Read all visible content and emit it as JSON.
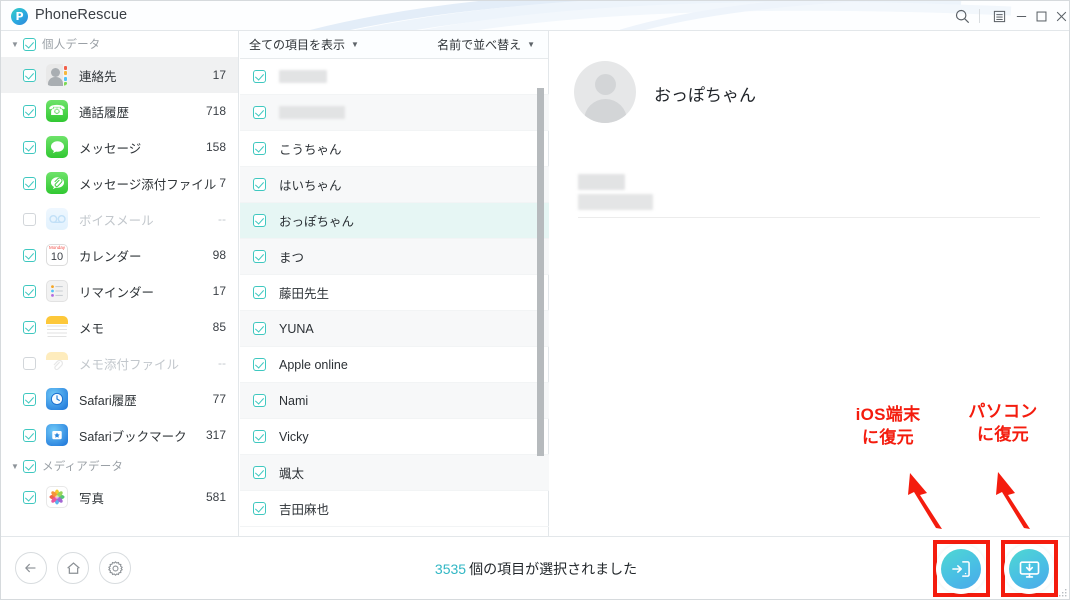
{
  "window": {
    "title": "PhoneRescue",
    "logo_glyph": "P",
    "controls": [
      {
        "name": "search-icon",
        "glyph": "search"
      },
      {
        "name": "menu-icon",
        "glyph": "menu"
      },
      {
        "name": "minimize-button",
        "glyph": "minimize"
      },
      {
        "name": "maximize-button",
        "glyph": "maximize"
      },
      {
        "name": "close-button",
        "glyph": "close"
      }
    ]
  },
  "sidebar": {
    "groups": [
      {
        "label": "個人データ",
        "checked": true,
        "expanded": true,
        "items": [
          {
            "label": "連絡先",
            "count": "17",
            "checked": true,
            "enabled": true,
            "selected": true,
            "icon": "contacts-icon"
          },
          {
            "label": "通話履歴",
            "count": "718",
            "checked": true,
            "enabled": true,
            "selected": false,
            "icon": "phone-icon"
          },
          {
            "label": "メッセージ",
            "count": "158",
            "checked": true,
            "enabled": true,
            "selected": false,
            "icon": "messages-icon"
          },
          {
            "label": "メッセージ添付ファイル",
            "count": "7",
            "checked": true,
            "enabled": true,
            "selected": false,
            "icon": "message-attachment-icon"
          },
          {
            "label": "ボイスメール",
            "count": "--",
            "checked": false,
            "enabled": false,
            "selected": false,
            "icon": "voicemail-icon"
          },
          {
            "label": "カレンダー",
            "count": "98",
            "checked": true,
            "enabled": true,
            "selected": false,
            "icon": "calendar-icon"
          },
          {
            "label": "リマインダー",
            "count": "17",
            "checked": true,
            "enabled": true,
            "selected": false,
            "icon": "reminders-icon"
          },
          {
            "label": "メモ",
            "count": "85",
            "checked": true,
            "enabled": true,
            "selected": false,
            "icon": "notes-icon"
          },
          {
            "label": "メモ添付ファイル",
            "count": "--",
            "checked": false,
            "enabled": false,
            "selected": false,
            "icon": "note-attachment-icon"
          },
          {
            "label": "Safari履歴",
            "count": "77",
            "checked": true,
            "enabled": true,
            "selected": false,
            "icon": "safari-history-icon"
          },
          {
            "label": "Safariブックマーク",
            "count": "317",
            "checked": true,
            "enabled": true,
            "selected": false,
            "icon": "safari-bookmark-icon"
          }
        ]
      },
      {
        "label": "メディアデータ",
        "checked": true,
        "expanded": true,
        "items": [
          {
            "label": "写真",
            "count": "581",
            "checked": true,
            "enabled": true,
            "selected": false,
            "icon": "photos-icon"
          }
        ]
      }
    ]
  },
  "list": {
    "filter_label": "全ての項目を表示",
    "sort_label": "名前で並べ替え",
    "rows": [
      {
        "name": "",
        "checked": true,
        "redacted": true,
        "redact_width": 48,
        "highlighted": false
      },
      {
        "name": "",
        "checked": true,
        "redacted": true,
        "redact_width": 66,
        "highlighted": false
      },
      {
        "name": "こうちゃん",
        "checked": true,
        "redacted": false,
        "highlighted": false
      },
      {
        "name": "はいちゃん",
        "checked": true,
        "redacted": false,
        "highlighted": false
      },
      {
        "name": "おっぽちゃん",
        "checked": true,
        "redacted": false,
        "highlighted": true
      },
      {
        "name": "まつ",
        "checked": true,
        "redacted": false,
        "highlighted": false
      },
      {
        "name": "藤田先生",
        "checked": true,
        "redacted": false,
        "highlighted": false
      },
      {
        "name": "YUNA",
        "checked": true,
        "redacted": false,
        "highlighted": false
      },
      {
        "name": "Apple online",
        "checked": true,
        "redacted": false,
        "highlighted": false
      },
      {
        "name": "Nami",
        "checked": true,
        "redacted": false,
        "highlighted": false
      },
      {
        "name": "Vicky",
        "checked": true,
        "redacted": false,
        "highlighted": false
      },
      {
        "name": "颯太",
        "checked": true,
        "redacted": false,
        "highlighted": false
      },
      {
        "name": "吉田麻也",
        "checked": true,
        "redacted": false,
        "highlighted": false
      }
    ]
  },
  "detail": {
    "contact_name": "おっぽちゃん",
    "field_label_redacted": true,
    "field_value_redacted": true
  },
  "bottom": {
    "nav": [
      {
        "name": "back-button",
        "glyph": "arrow-left"
      },
      {
        "name": "home-button",
        "glyph": "home"
      },
      {
        "name": "settings-button",
        "glyph": "gear"
      }
    ],
    "status_count": "3535",
    "status_text": "個の項目が選択されました",
    "actions": [
      {
        "name": "restore-to-ios-device-button",
        "icon": "phone-import-icon"
      },
      {
        "name": "restore-to-computer-button",
        "icon": "computer-download-icon"
      }
    ]
  },
  "annotations": [
    {
      "text": "iOS端末\nに復元",
      "target": "restore-to-ios-device-button"
    },
    {
      "text": "パソコン\nに復元",
      "target": "restore-to-computer-button"
    }
  ],
  "colors": {
    "accent": "#31b7c4",
    "checkbox": "#3fc8c0",
    "annotation": "#f41c0e",
    "selected_row": "#e6f6f4",
    "sidebar_selected": "#f0f1f2"
  }
}
